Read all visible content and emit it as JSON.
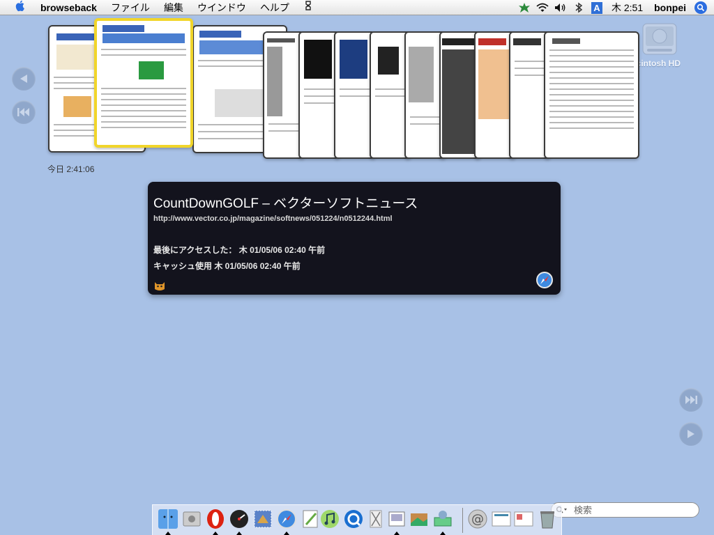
{
  "menubar": {
    "apple_icon": "apple-logo-icon",
    "app_name": "browseback",
    "menus": [
      "ファイル",
      "編集",
      "ウインドウ",
      "ヘルプ"
    ],
    "clock": "木 2:51",
    "user": "bonpei",
    "input_indicator": "A",
    "status_icons": [
      "script-icon",
      "leaf-icon",
      "wifi-icon",
      "volume-icon",
      "bluetooth-icon",
      "input-method-icon",
      "spotlight-icon"
    ]
  },
  "desktop": {
    "disk_label": "acintosh HD"
  },
  "timestamp": "今日 2:41:06",
  "info": {
    "title": "CountDownGOLF – ベクターソフトニュース",
    "url": "http://www.vector.co.jp/magazine/softnews/051224/n0512244.html",
    "last_access": "最後にアクセスした： 木 01/05/06 02:40 午前",
    "cache": "キャッシュ使用 木 01/05/06 02:40 午前"
  },
  "search": {
    "placeholder": "検索"
  },
  "colors": {
    "desktop": "#a8c1e6",
    "panel": "#13131d",
    "selection": "#f1d52a"
  },
  "dock": {
    "apps": [
      "finder",
      "system-prefs",
      "opera",
      "dashboard",
      "mail-stamp",
      "safari",
      "textedit",
      "itunes",
      "quicktime",
      "script-editor",
      "preview",
      "iphoto",
      "network",
      "mail-at",
      "documents",
      "web-pages",
      "trash"
    ]
  }
}
